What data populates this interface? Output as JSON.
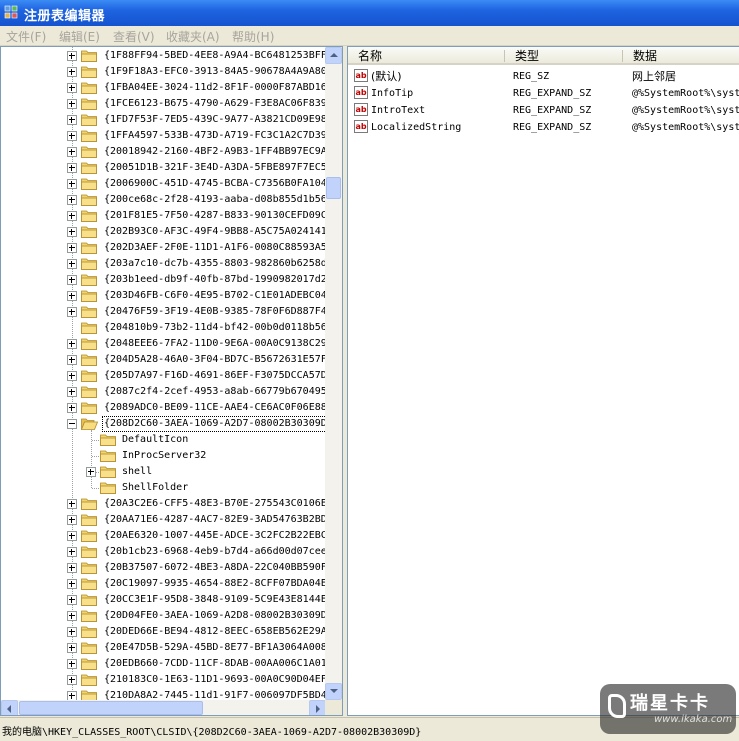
{
  "window": {
    "title": "注册表编辑器"
  },
  "menu": [
    "文件(F)",
    "编辑(E)",
    "查看(V)",
    "收藏夹(A)",
    "帮助(H)"
  ],
  "tree": {
    "above": [
      {
        "label": "{1F88FF94-5BED-4EE8-A9A4-BC6481253BFF",
        "expandable": true
      },
      {
        "label": "{1F9F18A3-EFC0-3913-84A5-90678A4A9A80",
        "expandable": true
      },
      {
        "label": "{1FBA04EE-3024-11d2-8F1F-0000F87ABD16",
        "expandable": true
      },
      {
        "label": "{1FCE6123-B675-4790-A629-F3E8AC06F839",
        "expandable": true
      },
      {
        "label": "{1FD7F53F-7ED5-439C-9A77-A3821CD09E98",
        "expandable": true
      },
      {
        "label": "{1FFA4597-533B-473D-A719-FC3C1A2C7D39",
        "expandable": true
      },
      {
        "label": "{20018942-2160-4BF2-A9B3-1FF4BB97EC9A",
        "expandable": true
      },
      {
        "label": "{20051D1B-321F-3E4D-A3DA-5FBE897F7EC5",
        "expandable": true
      },
      {
        "label": "{2006900C-451D-4745-BCBA-C7356B0FA104",
        "expandable": true
      },
      {
        "label": "{200ce68c-2f28-4193-aaba-d08b855d1b56",
        "expandable": true
      },
      {
        "label": "{201F81E5-7F50-4287-B833-90130CEFD09C",
        "expandable": true
      },
      {
        "label": "{202B93C0-AF3C-49F4-9BB8-A5C75A024141",
        "expandable": true
      },
      {
        "label": "{202D3AEF-2F0E-11D1-A1F6-0080C88593A5",
        "expandable": true
      },
      {
        "label": "{203a7c10-dc7b-4355-8803-982860b6258d",
        "expandable": true
      },
      {
        "label": "{203b1eed-db9f-40fb-87bd-1990982017d2",
        "expandable": true
      },
      {
        "label": "{203D46FB-C6F0-4E95-B702-C1E01ADEBC04",
        "expandable": true
      },
      {
        "label": "{20476F59-3F19-4E0B-9385-78F0F6D887F4",
        "expandable": true
      },
      {
        "label": "{204810b9-73b2-11d4-bf42-00b0d0118b56",
        "expandable": false
      },
      {
        "label": "{2048EEE6-7FA2-11D0-9E6A-00A0C9138C29",
        "expandable": true
      },
      {
        "label": "{204D5A28-46A0-3F04-BD7C-B5672631E57F",
        "expandable": true
      },
      {
        "label": "{205D7A97-F16D-4691-86EF-F3075DCCA57D",
        "expandable": true
      },
      {
        "label": "{2087c2f4-2cef-4953-a8ab-66779b670495",
        "expandable": true
      },
      {
        "label": "{2089ADC0-BE09-11CE-AAE4-CE6AC0F06E88",
        "expandable": true
      }
    ],
    "selected": {
      "label": "{208D2C60-3AEA-1069-A2D7-08002B30309D}"
    },
    "children": [
      {
        "label": "DefaultIcon",
        "expandable": false
      },
      {
        "label": "InProcServer32",
        "expandable": false
      },
      {
        "label": "shell",
        "expandable": true
      },
      {
        "label": "ShellFolder",
        "expandable": false
      }
    ],
    "below": [
      {
        "label": "{20A3C2E6-CFF5-48E3-B70E-275543C0106E",
        "expandable": true
      },
      {
        "label": "{20AA71E6-4287-4AC7-82E9-3AD54763B2BD",
        "expandable": true
      },
      {
        "label": "{20AE6320-1007-445E-ADCE-3C2FC2B22EBC",
        "expandable": true
      },
      {
        "label": "{20b1cb23-6968-4eb9-b7d4-a66d00d07cee",
        "expandable": true
      },
      {
        "label": "{20B37507-6072-4BE3-A8DA-22C040BB590F",
        "expandable": true
      },
      {
        "label": "{20C19097-9935-4654-88E2-8CFF07BDA04E",
        "expandable": true
      },
      {
        "label": "{20CC3E1F-95D8-3848-9109-5C9E43E8144E",
        "expandable": true
      },
      {
        "label": "{20D04FE0-3AEA-1069-A2D8-08002B30309D",
        "expandable": true
      },
      {
        "label": "{20DED66E-BE94-4812-8EEC-658EB562E29A",
        "expandable": true
      },
      {
        "label": "{20E47D5B-529A-45BD-8E77-BF1A3064A008",
        "expandable": true
      },
      {
        "label": "{20EDB660-7CDD-11CF-8DAB-00AA006C1A01",
        "expandable": true
      },
      {
        "label": "{210183C0-1E63-11D1-9693-00A0C90D04EF",
        "expandable": true
      },
      {
        "label": "{210DA8A2-7445-11d1-91F7-006097DF5BD4",
        "expandable": true
      }
    ]
  },
  "values": {
    "columns": [
      "名称",
      "类型",
      "数据"
    ],
    "rows": [
      {
        "name": "(默认)",
        "type": "REG_SZ",
        "data": "网上邻居"
      },
      {
        "name": "InfoTip",
        "type": "REG_EXPAND_SZ",
        "data": "@%SystemRoot%\\syst"
      },
      {
        "name": "IntroText",
        "type": "REG_EXPAND_SZ",
        "data": "@%SystemRoot%\\syst"
      },
      {
        "name": "LocalizedString",
        "type": "REG_EXPAND_SZ",
        "data": "@%SystemRoot%\\syst"
      }
    ]
  },
  "status": {
    "path": "我的电脑\\HKEY_CLASSES_ROOT\\CLSID\\{208D2C60-3AEA-1069-A2D7-08002B30309D}"
  },
  "watermark": {
    "title": "瑞星卡卡",
    "url": "www.ikaka.com"
  },
  "colors": {
    "title_bar": "#1e63e0",
    "folder": "#f4d36b",
    "selection_border": "#000000"
  },
  "icons": {
    "folder": "folder-icon",
    "string_value": "string-value-icon",
    "app": "regedit-icon"
  }
}
